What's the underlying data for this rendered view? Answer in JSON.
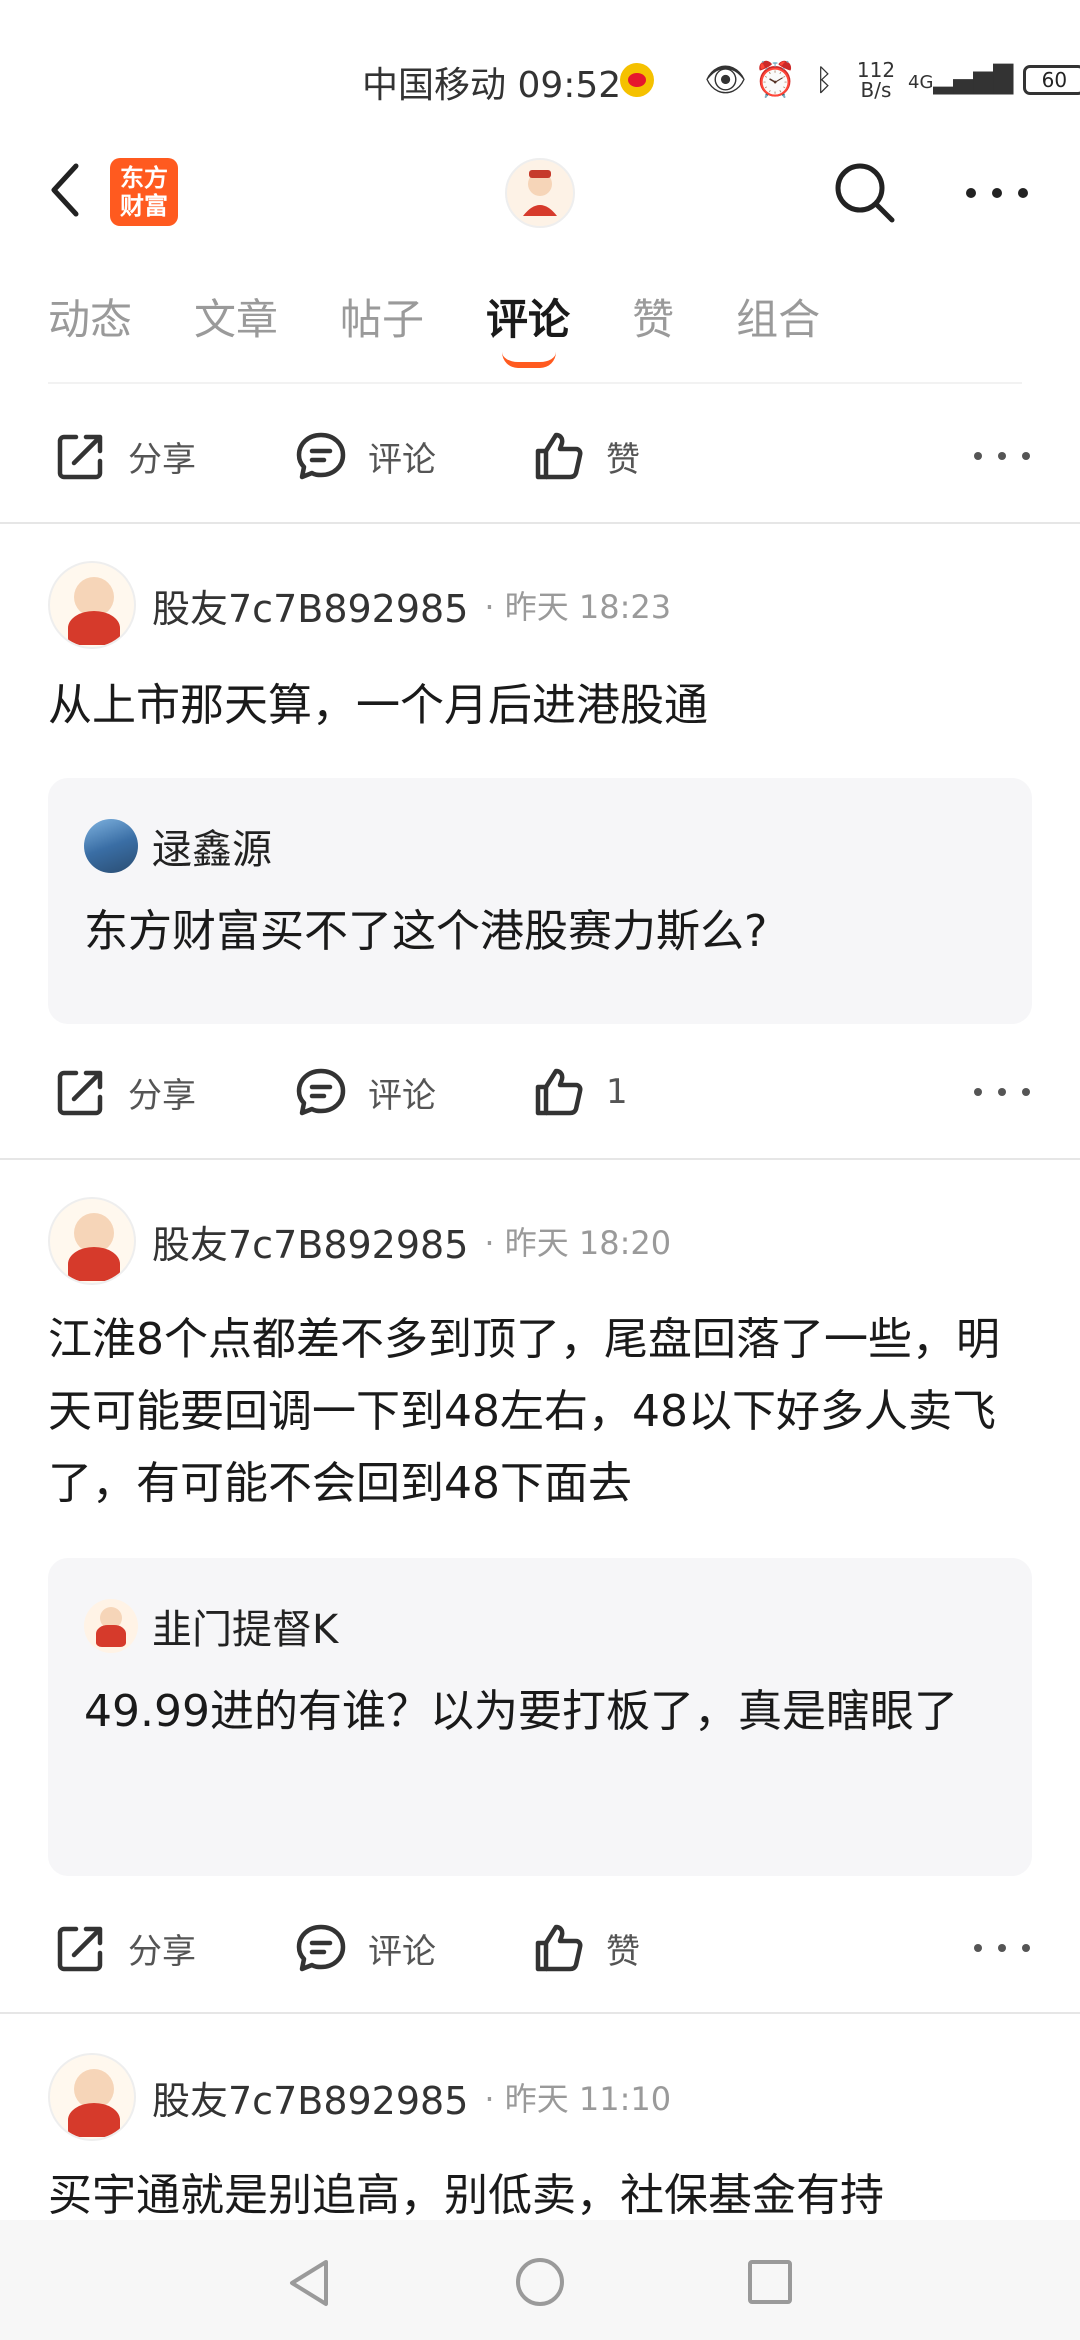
{
  "status_bar": {
    "carrier_time": "中国移动 09:52",
    "net_speed_value": "112",
    "net_speed_unit": "B/s",
    "network": "4G",
    "battery": "60"
  },
  "header": {
    "brand_line1": "东方",
    "brand_line2": "财富"
  },
  "tabs": [
    {
      "label": "动态"
    },
    {
      "label": "文章"
    },
    {
      "label": "帖子"
    },
    {
      "label": "评论"
    },
    {
      "label": "赞"
    },
    {
      "label": "组合"
    }
  ],
  "active_tab": "评论",
  "actions": {
    "share": "分享",
    "comment": "评论",
    "like": "赞"
  },
  "posts": [
    {
      "username": "股友7c7B892985",
      "time": "· 昨天 18:23",
      "body": "从上市那天算，一个月后进港股通",
      "quote": {
        "name": "逯鑫源",
        "text": "东方财富买不了这个港股赛力斯么?"
      },
      "like_count": "1"
    },
    {
      "username": "股友7c7B892985",
      "time": "· 昨天 18:20",
      "body": "江淮8个点都差不多到顶了，尾盘回落了一些，明天可能要回调一下到48左右，48以下好多人卖飞了，有可能不会回到48下面去",
      "quote": {
        "name": "韭门提督K",
        "text": "49.99进的有谁？以为要打板了，真是瞎眼了"
      },
      "like_label": "赞"
    },
    {
      "username": "股友7c7B892985",
      "time": "· 昨天 11:10",
      "body": "买宇通就是别追高，别低卖，社保基金有持"
    }
  ]
}
